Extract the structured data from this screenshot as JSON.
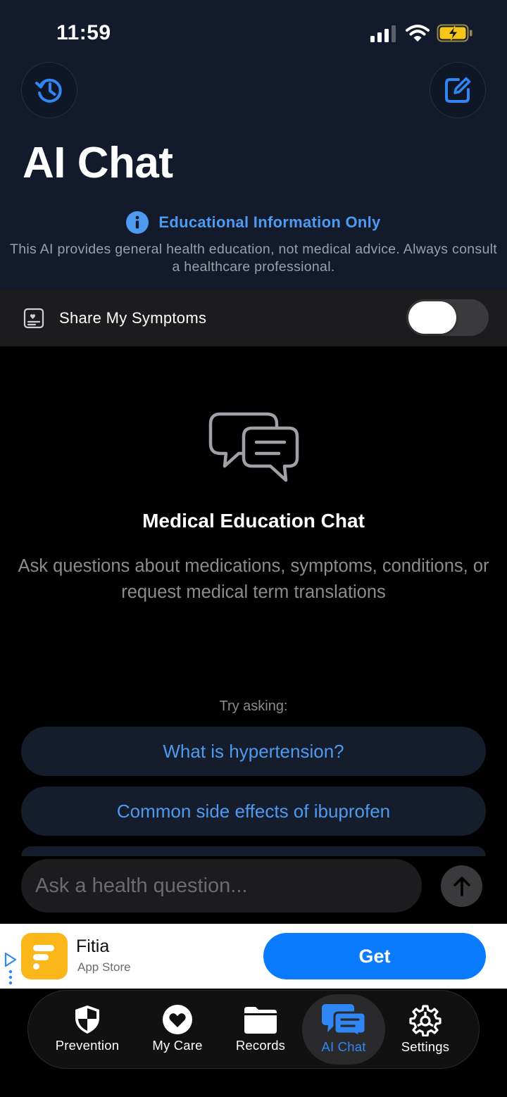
{
  "status_bar": {
    "time": "11:59"
  },
  "header": {
    "title": "AI Chat",
    "history_icon": "clock-history-icon",
    "compose_icon": "compose-icon"
  },
  "disclaimer": {
    "title": "Educational Information Only",
    "text": "This AI provides general health education, not medical advice. Always consult a healthcare professional.",
    "accent": "#4d9bf0"
  },
  "share_symptoms": {
    "label": "Share My Symptoms",
    "enabled": false
  },
  "empty_state": {
    "title": "Medical Education Chat",
    "description": "Ask questions about medications, symptoms, conditions, or request medical term translations"
  },
  "suggestions": {
    "label": "Try asking:",
    "items": [
      "What is hypertension?",
      "Common side effects of ibuprofen"
    ]
  },
  "input": {
    "placeholder": "Ask a health question..."
  },
  "ad": {
    "app_name": "Fitia",
    "store": "App Store",
    "cta": "Get",
    "cta_color": "#0a7aff"
  },
  "tabs": [
    {
      "label": "Prevention",
      "icon": "shield-icon"
    },
    {
      "label": "My Care",
      "icon": "heart-icon"
    },
    {
      "label": "Records",
      "icon": "folder-icon"
    },
    {
      "label": "AI Chat",
      "icon": "chat-bubbles-icon",
      "active": true
    },
    {
      "label": "Settings",
      "icon": "gear-icon"
    }
  ],
  "colors": {
    "tab_active": "#2f86f5",
    "header_bg": "#121a2b"
  }
}
